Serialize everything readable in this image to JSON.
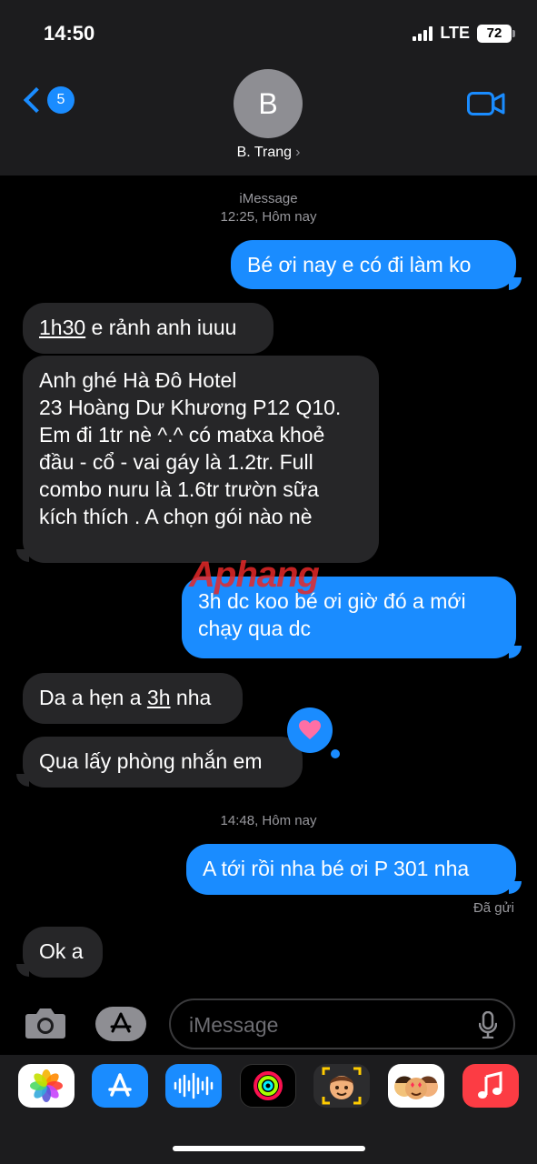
{
  "status": {
    "time": "14:50",
    "network": "LTE",
    "battery": "72"
  },
  "nav": {
    "back_count": "5",
    "avatar_initial": "B",
    "contact_name": "B. Trang",
    "contact_chevron": "›"
  },
  "thread": {
    "service": "iMessage",
    "time1": "12:25, Hôm nay",
    "time2": "14:48, Hôm nay",
    "delivered": "Đã gửi"
  },
  "messages": {
    "m1": "Bé ơi nay e có đi làm ko",
    "m2a": "1h30",
    "m2b": " e rảnh anh iuuu",
    "m3_lines": [
      "Anh ghé Hà Đô Hotel",
      "23 Hoàng Dư Khương P12 Q10.",
      "Em đi 1tr nè ^.^ có matxa khoẻ",
      "đầu - cổ - vai gáy là 1.2tr. Full",
      "combo nuru là 1.6tr trườn sữa",
      "kích thích . A chọn gói nào nè"
    ],
    "m4_lines": [
      "3h dc koo bé ơi giờ đó a mới",
      "chạy qua dc"
    ],
    "m5a": "Da a hẹn a ",
    "m5b": "3h",
    "m5c": " nha",
    "m6": "Qua lấy phòng nhắn em",
    "m7": "A tới rồi nha bé ơi P 301 nha",
    "m8": "Ok a"
  },
  "watermark": {
    "part1": "Aphang",
    "part2": ""
  },
  "composer": {
    "placeholder": "iMessage"
  },
  "icons": {
    "back": "chevron-left-icon",
    "video": "video-camera-icon",
    "camera": "camera-icon",
    "apps": "app-store-icon",
    "mic": "microphone-icon",
    "reaction": "heart-icon"
  },
  "colors": {
    "accent": "#1a8cff",
    "incoming_bubble": "#262628",
    "header_bg": "#1c1c1e"
  }
}
